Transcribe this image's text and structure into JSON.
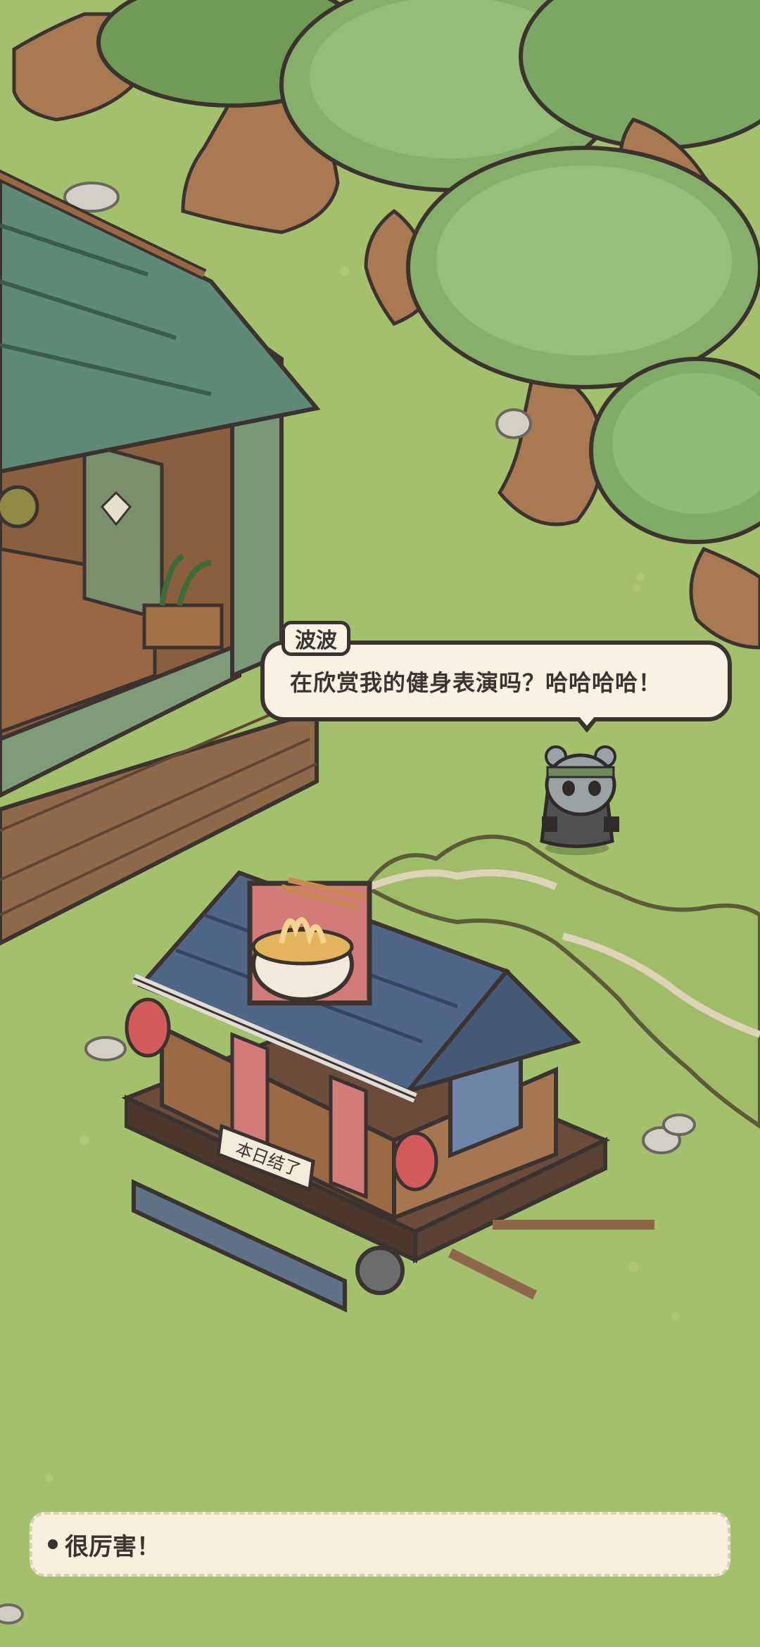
{
  "dialogue": {
    "speaker": "波波",
    "text": "在欣赏我的健身表演吗？哈哈哈哈！"
  },
  "choices": [
    {
      "label": "很厉害！"
    }
  ],
  "scene": {
    "sign_text": "本日结了"
  },
  "colors": {
    "grass": "#a3c06b",
    "bubble": "#f7f2e1",
    "outline": "#3b3330"
  }
}
